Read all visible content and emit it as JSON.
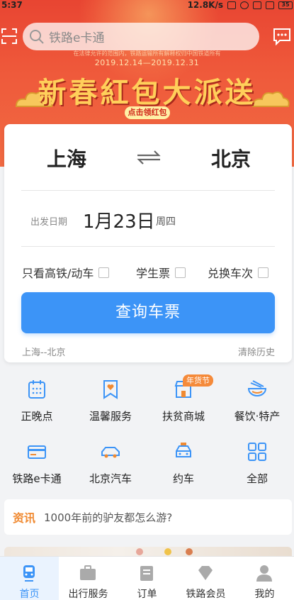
{
  "status_bar": {
    "time": "5:37",
    "network_speed": "12.8K/s",
    "battery": "35"
  },
  "search": {
    "placeholder": "铁路e卡通"
  },
  "banner": {
    "small_text": "在法律允许的范围内，铁路运输所有解释权归中国铁道所有",
    "dates": "2019.12.14—2019.12.31",
    "headline": "新春紅包大派送",
    "cta": "点击领红包"
  },
  "booking": {
    "from_city": "上海",
    "to_city": "北京",
    "date_label": "出发日期",
    "date_value": "1月23日",
    "weekday": "周四",
    "options": [
      {
        "label": "只看高铁/动车",
        "checked": false
      },
      {
        "label": "学生票",
        "checked": false
      },
      {
        "label": "兑换车次",
        "checked": false
      }
    ],
    "query_button": "查询车票",
    "history": "上海--北京",
    "clear_history": "清除历史"
  },
  "services": [
    {
      "label": "正晚点",
      "icon": "calendar-icon"
    },
    {
      "label": "温馨服务",
      "icon": "heart-bookmark-icon"
    },
    {
      "label": "扶贫商城",
      "icon": "shop-icon",
      "tag": "年货节"
    },
    {
      "label": "餐饮·特产",
      "icon": "noodle-bowl-icon"
    },
    {
      "label": "铁路e卡通",
      "icon": "card-icon"
    },
    {
      "label": "北京汽车",
      "icon": "car-icon"
    },
    {
      "label": "约车",
      "icon": "taxi-icon"
    },
    {
      "label": "全部",
      "icon": "grid-icon"
    }
  ],
  "news": {
    "badge": "资讯",
    "text": "1000年前的驴友都怎么游?"
  },
  "tabs": [
    {
      "label": "首页",
      "icon": "train-icon",
      "active": true
    },
    {
      "label": "出行服务",
      "icon": "briefcase-icon",
      "active": false
    },
    {
      "label": "订单",
      "icon": "order-icon",
      "active": false
    },
    {
      "label": "铁路会员",
      "icon": "diamond-icon",
      "active": false
    },
    {
      "label": "我的",
      "icon": "user-icon",
      "active": false
    }
  ],
  "colors": {
    "accent": "#3c94f7",
    "banner_red": "#e84532",
    "gold": "#ffcf5a",
    "orange": "#f08a32"
  }
}
